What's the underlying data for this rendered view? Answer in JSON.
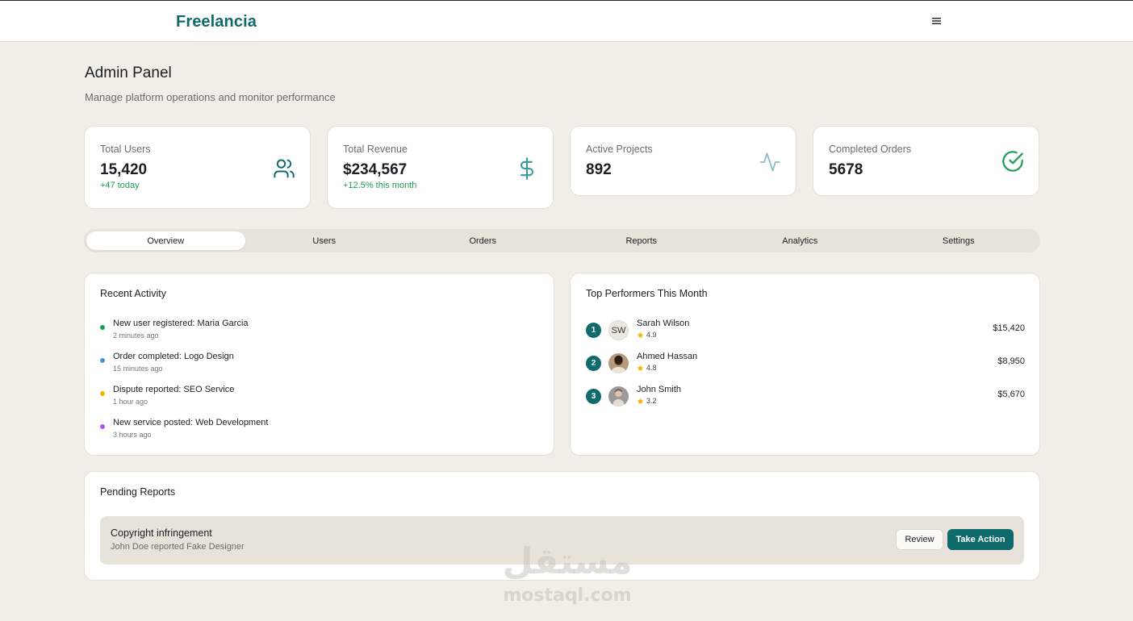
{
  "header": {
    "brand": "Freelancia",
    "menu_icon": "hamburger-icon"
  },
  "page": {
    "title": "Admin Panel",
    "subtitle": "Manage platform operations and monitor performance"
  },
  "stats": [
    {
      "label": "Total Users",
      "value": "15,420",
      "delta": "+47 today",
      "icon": "users-icon"
    },
    {
      "label": "Total Revenue",
      "value": "$234,567",
      "delta": "+12.5% this month",
      "icon": "dollar-icon"
    },
    {
      "label": "Active Projects",
      "value": "892",
      "icon": "activity-icon"
    },
    {
      "label": "Completed Orders",
      "value": "5678",
      "icon": "check-circle-icon"
    }
  ],
  "tabs": [
    {
      "label": "Overview",
      "active": true
    },
    {
      "label": "Users"
    },
    {
      "label": "Orders"
    },
    {
      "label": "Reports"
    },
    {
      "label": "Analytics"
    },
    {
      "label": "Settings"
    }
  ],
  "recent_activity": {
    "title": "Recent Activity",
    "items": [
      {
        "text": "New user registered: Maria Garcia",
        "time": "2 minutes ago",
        "color": "#1f9d55"
      },
      {
        "text": "Order completed: Logo Design",
        "time": "15 minutes ago",
        "color": "#4a90d9"
      },
      {
        "text": "Dispute reported: SEO Service",
        "time": "1 hour ago",
        "color": "#f5b400"
      },
      {
        "text": "New service posted: Web Development",
        "time": "3 hours ago",
        "color": "#a855f7"
      }
    ]
  },
  "top_performers": {
    "title": "Top Performers This Month",
    "items": [
      {
        "rank": "1",
        "initials": "SW",
        "name": "Sarah Wilson",
        "rating": "4.9",
        "amount": "$15,420"
      },
      {
        "rank": "2",
        "initials": "",
        "name": "Ahmed Hassan",
        "rating": "4.8",
        "amount": "$8,950"
      },
      {
        "rank": "3",
        "initials": "",
        "name": "John Smith",
        "rating": "3.2",
        "amount": "$5,670"
      }
    ]
  },
  "pending_reports": {
    "title": "Pending Reports",
    "items": [
      {
        "title": "Copyright infringement",
        "detail": "John Doe reported Fake Designer",
        "review_label": "Review",
        "action_label": "Take Action"
      }
    ]
  },
  "watermark": {
    "arabic": "مستقل",
    "latin": "mostaql.com"
  },
  "colors": {
    "brand": "#0f6b6b",
    "background": "#f1eee7",
    "positive": "#1f9d55",
    "star": "#f5b400"
  }
}
